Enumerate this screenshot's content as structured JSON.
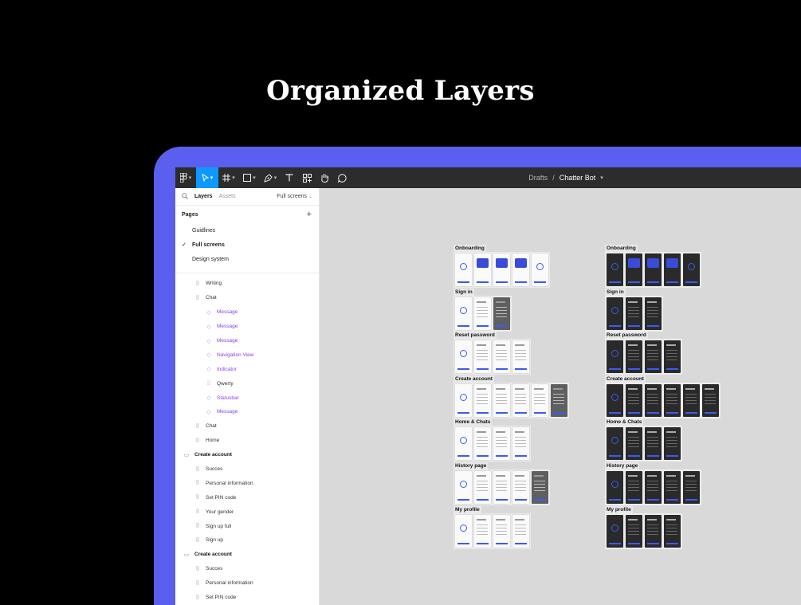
{
  "headline": "Organized Layers",
  "colors": {
    "accent": "#5b5ff0",
    "toolbar_active": "#0d99ff",
    "component": "#8a3ff0"
  },
  "toolbar": {
    "icons": [
      "figma-menu-icon",
      "move-tool-icon",
      "frame-tool-icon",
      "shape-tool-icon",
      "pen-tool-icon",
      "text-tool-icon",
      "components-icon",
      "hand-tool-icon",
      "comment-icon"
    ],
    "breadcrumb": {
      "project": "Drafts",
      "separator": "/",
      "file": "Chatter Bot"
    }
  },
  "sidebar": {
    "tabs": {
      "layers": "Layers",
      "assets": "Assets",
      "current_page": "Full screens"
    },
    "pages_title": "Pages",
    "pages": [
      {
        "label": "Guidlines",
        "selected": false
      },
      {
        "label": "Full screens",
        "selected": true
      },
      {
        "label": "Design system",
        "selected": false
      }
    ],
    "layers": [
      {
        "label": "Writing",
        "indent": 1,
        "kind": "frame"
      },
      {
        "label": "Chat",
        "indent": 1,
        "kind": "frame"
      },
      {
        "label": "Message",
        "indent": 2,
        "kind": "component"
      },
      {
        "label": "Message",
        "indent": 2,
        "kind": "component"
      },
      {
        "label": "Message",
        "indent": 2,
        "kind": "component"
      },
      {
        "label": "Navigation View",
        "indent": 2,
        "kind": "component"
      },
      {
        "label": "Indicator",
        "indent": 2,
        "kind": "component"
      },
      {
        "label": "Qwerty",
        "indent": 2,
        "kind": "group"
      },
      {
        "label": "Statusbar",
        "indent": 2,
        "kind": "component"
      },
      {
        "label": "Message",
        "indent": 2,
        "kind": "component"
      },
      {
        "label": "Chat",
        "indent": 1,
        "kind": "frame"
      },
      {
        "label": "Home",
        "indent": 1,
        "kind": "frame"
      },
      {
        "label": "Create account",
        "indent": 0,
        "kind": "section"
      },
      {
        "label": "Succes",
        "indent": 1,
        "kind": "frame"
      },
      {
        "label": "Personal information",
        "indent": 1,
        "kind": "frame"
      },
      {
        "label": "Set PIN code",
        "indent": 1,
        "kind": "frame"
      },
      {
        "label": "Your gender",
        "indent": 1,
        "kind": "frame"
      },
      {
        "label": "Sign up full",
        "indent": 1,
        "kind": "frame"
      },
      {
        "label": "Sign up",
        "indent": 1,
        "kind": "frame"
      },
      {
        "label": "Create account",
        "indent": 0,
        "kind": "section"
      },
      {
        "label": "Succes",
        "indent": 1,
        "kind": "frame"
      },
      {
        "label": "Personal information",
        "indent": 1,
        "kind": "frame"
      },
      {
        "label": "Set PIN code",
        "indent": 1,
        "kind": "frame"
      }
    ]
  },
  "canvas": {
    "columns": [
      {
        "theme": "light",
        "sections": [
          {
            "label": "Onboarding",
            "screens": 5
          },
          {
            "label": "Sign in",
            "screens": 3
          },
          {
            "label": "Reset password",
            "screens": 4
          },
          {
            "label": "Create account",
            "screens": 6
          },
          {
            "label": "Home & Chats",
            "screens": 4
          },
          {
            "label": "History page",
            "screens": 5
          },
          {
            "label": "My profile",
            "screens": 4
          }
        ]
      },
      {
        "theme": "dark",
        "sections": [
          {
            "label": "Onboarding",
            "screens": 5
          },
          {
            "label": "Sign in",
            "screens": 3
          },
          {
            "label": "Reset password",
            "screens": 4
          },
          {
            "label": "Create account",
            "screens": 6
          },
          {
            "label": "Home & Chats",
            "screens": 4
          },
          {
            "label": "History page",
            "screens": 5
          },
          {
            "label": "My profile",
            "screens": 4
          }
        ]
      }
    ]
  }
}
